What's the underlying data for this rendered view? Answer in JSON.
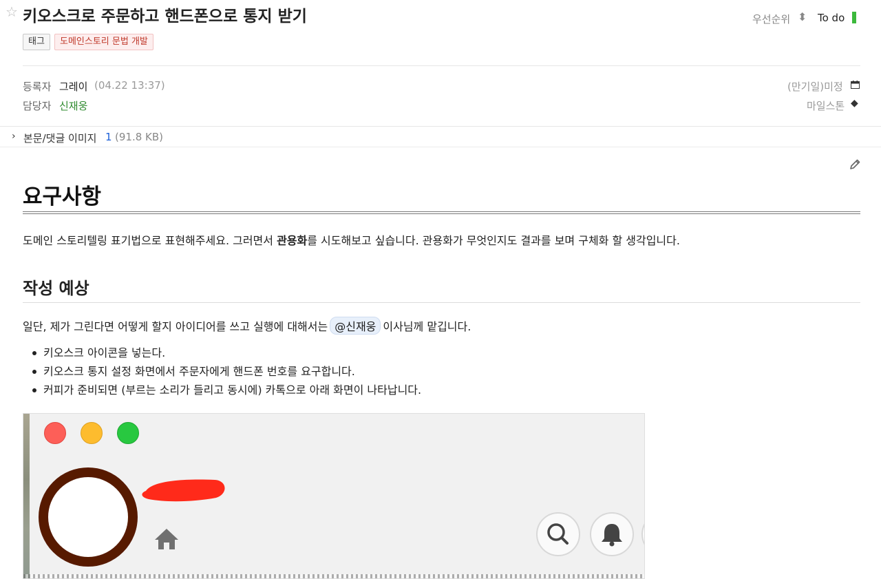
{
  "header": {
    "title": "키오스크로 주문하고 핸드폰으로 통지 받기",
    "priority_label": "우선순위",
    "status_label": "To do",
    "status_color": "#3cb93c"
  },
  "tags": {
    "tag_label": "태그",
    "category": "도메인스토리 문법 개발"
  },
  "meta": {
    "registrant_key": "등록자",
    "registrant": "그레이",
    "registered_time": "(04.22 13:37)",
    "assignee_key": "담당자",
    "assignee": "신재웅",
    "due_label": "(만기일)미정",
    "milestone_label": "마일스톤"
  },
  "attachments": {
    "label": "본문/댓글 이미지",
    "count": "1",
    "size": "(91.8 KB)"
  },
  "body": {
    "h1": "요구사항",
    "para1_a": "도메인 스토리텔링 표기법으로 표현해주세요. 그러면서 ",
    "para1_bold": "관용화",
    "para1_b": "를 시도해보고 싶습니다. 관용화가 무엇인지도 결과를 보며 구체화 할 생각입니다.",
    "h2": "작성 예상",
    "para2_a": "일단, 제가 그린다면 어떻게 할지 아이디어를 쓰고 실행에 대해서는",
    "mention": "@신재웅",
    "para2_b": "이사님께 맡깁니다.",
    "bullets": [
      "키오스크 아이콘을 넣는다.",
      "키오스크 통지 설정 화면에서 주문자에게 핸드폰 번호를 요구합니다.",
      "커피가 준비되면 (부르는 소리가 들리고 동시에) 카톡으로 아래 화면이 나타납니다."
    ]
  },
  "icons": {
    "star": "star-icon",
    "priority": "updown-arrow-icon",
    "due": "calendar-icon",
    "milestone": "diamond-icon",
    "attach": "chevron-right-icon",
    "edit": "pencil-icon",
    "home": "home-icon",
    "search": "search-icon",
    "bell": "bell-icon"
  }
}
